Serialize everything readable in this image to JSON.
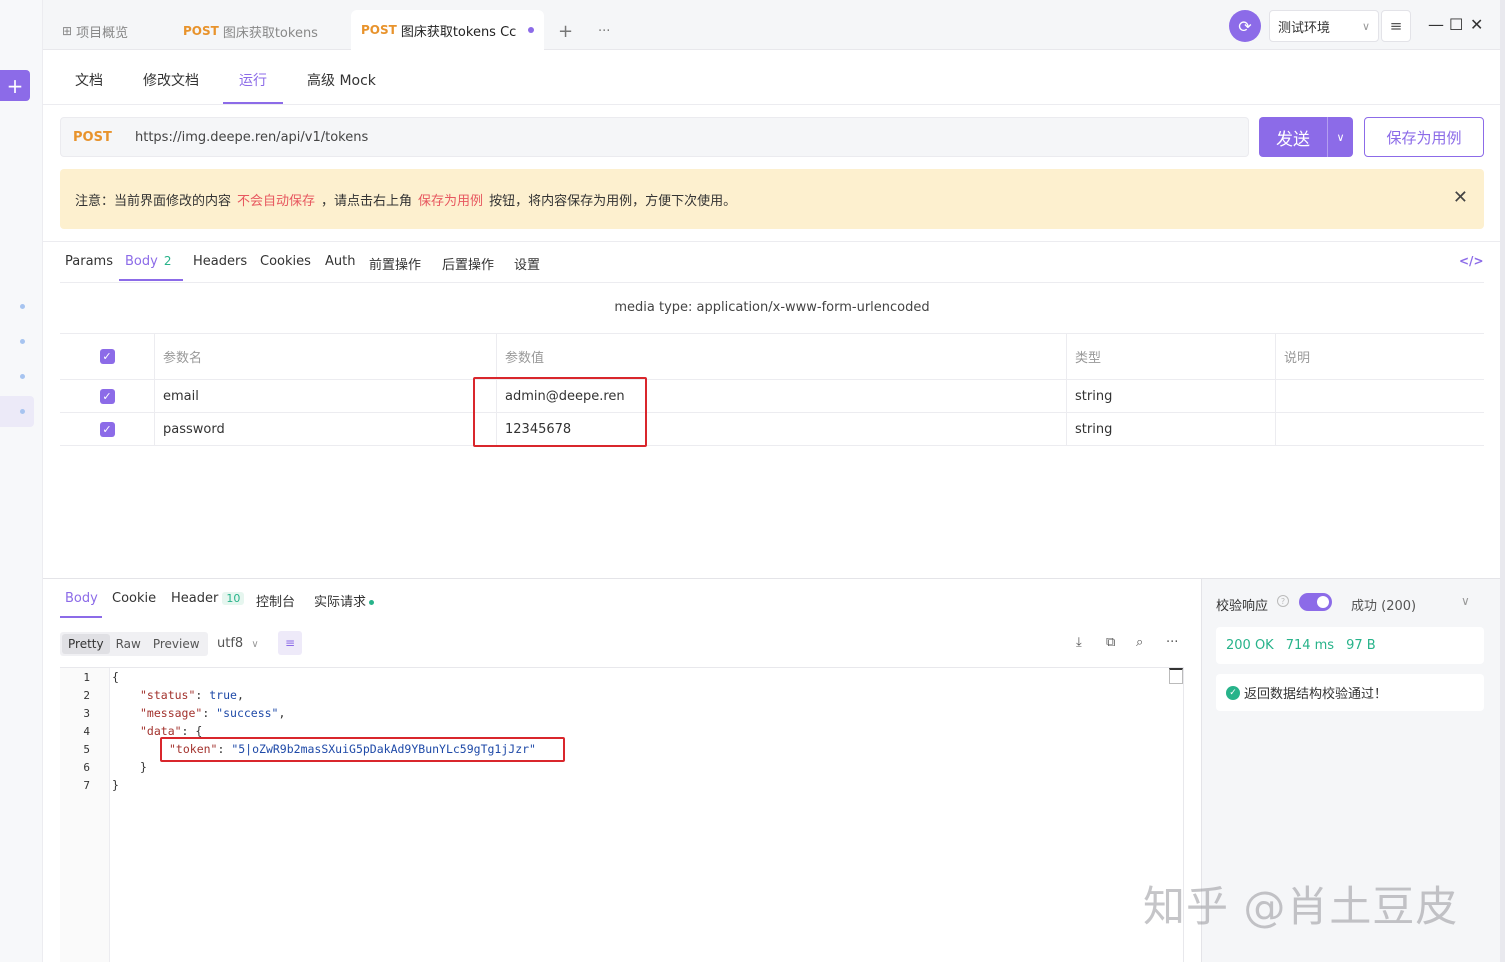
{
  "tabbar": {
    "overview_label": "项目概览",
    "tab1_method": "POST",
    "tab1_title": "图床获取tokens",
    "tab2_method": "POST",
    "tab2_title": "图床获取tokens Cc",
    "add_tab": "+",
    "more_tabs": "···",
    "env_name": "测试环境"
  },
  "subtabs": [
    "文档",
    "修改文档",
    "运行",
    "高级 Mock"
  ],
  "request": {
    "method": "POST",
    "url": "https://img.deepe.ren/api/v1/tokens",
    "send_label": "发送",
    "save_case_label": "保存为用例"
  },
  "notice": {
    "part1": "注意：当前界面修改的内容",
    "highlight1": "不会自动保存",
    "part2": "，请点击右上角",
    "highlight2": "保存为用例",
    "part3": "按钮，将内容保存为用例，方便下次使用。"
  },
  "reqtabs": {
    "params": "Params",
    "body": "Body",
    "body_count": "2",
    "headers": "Headers",
    "cookies": "Cookies",
    "auth": "Auth",
    "pre": "前置操作",
    "post": "后置操作",
    "settings": "设置",
    "code_icon": "</>"
  },
  "media_type": "media type: application/x-www-form-urlencoded",
  "params_table": {
    "headers": [
      "参数名",
      "参数值",
      "类型",
      "说明"
    ],
    "rows": [
      {
        "name": "email",
        "value": "admin@deepe.ren",
        "type": "string",
        "desc": ""
      },
      {
        "name": "password",
        "value": "12345678",
        "type": "string",
        "desc": ""
      }
    ]
  },
  "response": {
    "tabs": {
      "body": "Body",
      "cookie": "Cookie",
      "header": "Header",
      "header_count": "10",
      "console": "控制台",
      "actual": "实际请求"
    },
    "formats": [
      "Pretty",
      "Raw",
      "Preview"
    ],
    "encoding": "utf8",
    "code_lines": {
      "l1": "{",
      "l2_key": "\"status\"",
      "l2_val": "true",
      "l3_key": "\"message\"",
      "l3_val": "\"success\"",
      "l4_key": "\"data\"",
      "l4_rest": ": {",
      "l5_key": "\"token\"",
      "l5_val": "\"5|oZwR9b2masSXuiG5pDakAd9YBunYLc59gTg1jJzr\"",
      "l6": "}",
      "l7": "}"
    },
    "line_numbers": [
      "1",
      "2",
      "3",
      "4",
      "5",
      "6",
      "7"
    ]
  },
  "validation": {
    "label": "校验响应",
    "status": "成功 (200)",
    "http_status": "200 OK",
    "time": "714 ms",
    "size": "97 B",
    "check_msg": "返回数据结构校验通过！"
  },
  "watermark": "知乎 @肖土豆皮",
  "colors": {
    "accent": "#8c6be8",
    "post": "#e8932c",
    "success": "#27b38a",
    "warning_bg": "#fdf0cf",
    "highlight_red": "#e7575f"
  }
}
